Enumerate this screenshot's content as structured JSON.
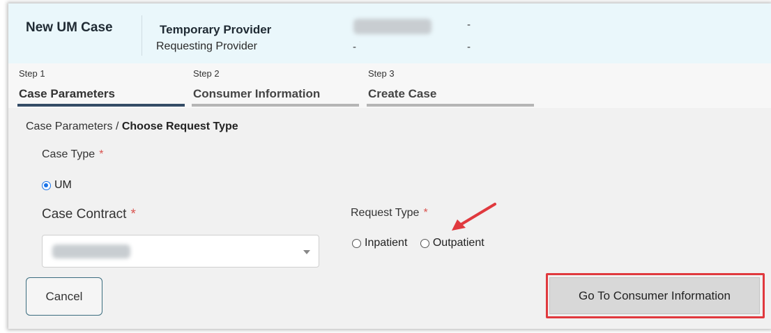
{
  "header": {
    "app_title": "New UM Case",
    "provider_name": "Temporary Provider",
    "provider_role": "Requesting Provider",
    "dash_1": "-",
    "dash_2": "-",
    "dash_3": "-"
  },
  "steps": [
    {
      "number": "Step 1",
      "name": "Case Parameters",
      "active": true
    },
    {
      "number": "Step 2",
      "name": "Consumer Information",
      "active": false
    },
    {
      "number": "Step 3",
      "name": "Create Case",
      "active": false
    }
  ],
  "breadcrumb": {
    "parent": "Case Parameters",
    "separator": " / ",
    "current": "Choose Request Type"
  },
  "case_type": {
    "label": "Case Type",
    "required_mark": "*",
    "options": [
      {
        "label": "UM",
        "checked": true
      }
    ]
  },
  "case_contract": {
    "label": "Case Contract",
    "required_mark": "*"
  },
  "request_type": {
    "label": "Request Type",
    "required_mark": "*",
    "options": [
      {
        "label": "Inpatient",
        "checked": false
      },
      {
        "label": "Outpatient",
        "checked": false
      }
    ]
  },
  "buttons": {
    "cancel": "Cancel",
    "next": "Go To Consumer Information"
  },
  "colors": {
    "active_step": "#344c66",
    "header_bg": "#eaf7fb",
    "required": "#d9534f",
    "highlight": "#e0393e",
    "radio_checked": "#1a73e8"
  }
}
